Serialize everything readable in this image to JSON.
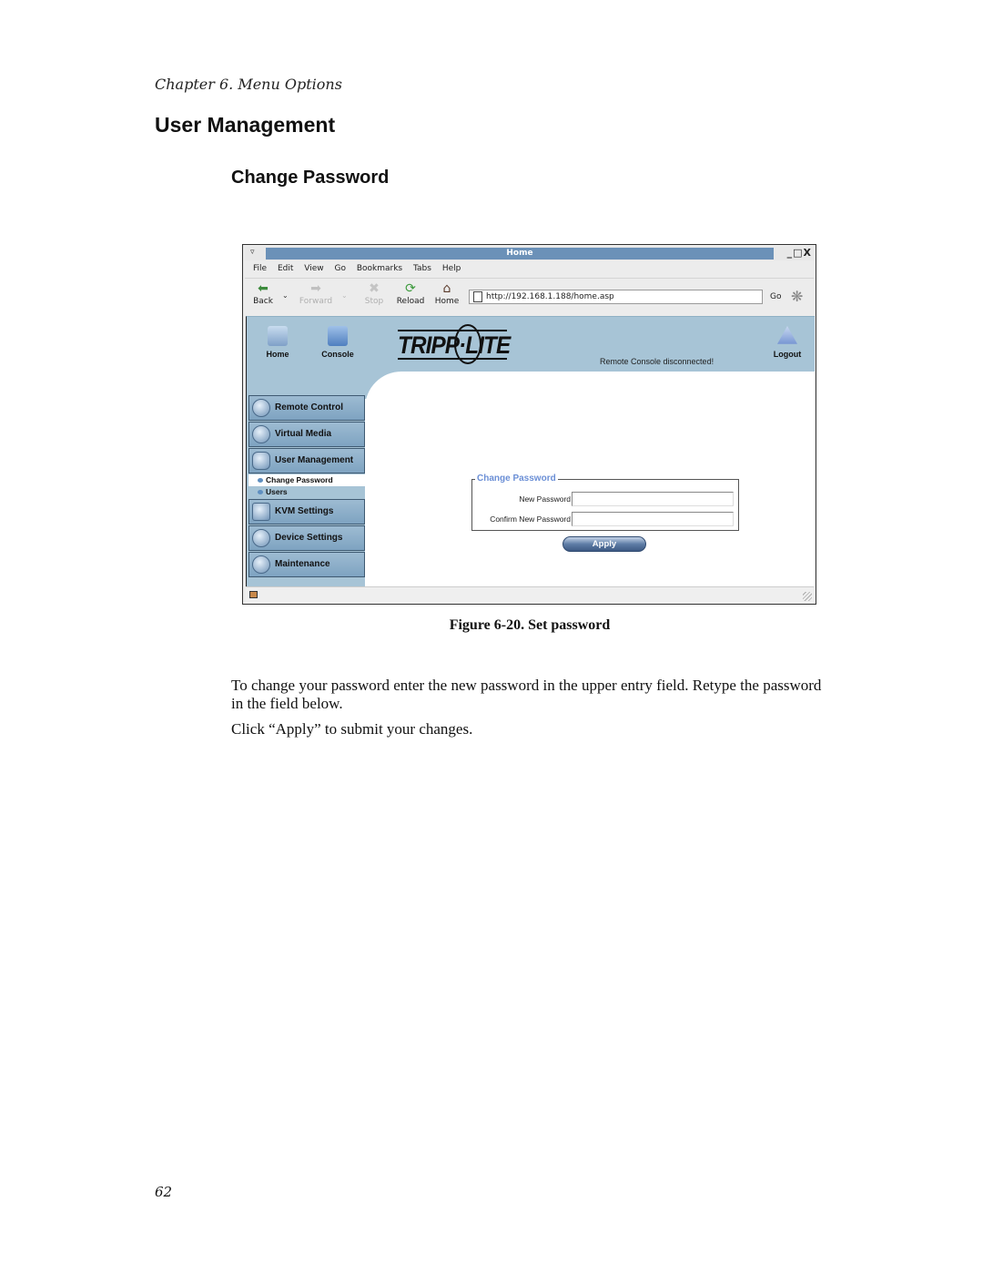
{
  "document": {
    "chapter_header": "Chapter 6. Menu Options",
    "section_title": "User Management",
    "subsection_title": "Change Password",
    "figure_caption": "Figure 6-20. Set password",
    "paragraphs": [
      "To change your password enter the new password in the upper entry field. Retype the password in the field below.",
      "Click “Apply” to submit your changes."
    ],
    "page_number": "62"
  },
  "window": {
    "title": "Home",
    "window_menu_icon": "window-menu-icon",
    "controls": "_□X"
  },
  "menubar": {
    "items": [
      "File",
      "Edit",
      "View",
      "Go",
      "Bookmarks",
      "Tabs",
      "Help"
    ]
  },
  "toolbar": {
    "back": "Back",
    "forward": "Forward",
    "stop": "Stop",
    "reload": "Reload",
    "home": "Home",
    "url": "http://192.168.1.188/home.asp",
    "go": "Go"
  },
  "app": {
    "header_nav": {
      "home": "Home",
      "console": "Console",
      "logout": "Logout"
    },
    "logo_text": "TRIPP·LITE",
    "status_text": "Remote Console disconnected!",
    "sidebar": {
      "items": [
        "Remote Control",
        "Virtual Media",
        "User Management"
      ],
      "subitems": [
        "Change Password",
        "Users"
      ],
      "items_after": [
        "KVM Settings",
        "Device Settings",
        "Maintenance"
      ]
    },
    "form": {
      "legend": "Change Password",
      "new_password_label": "New Password",
      "new_password_value": "",
      "confirm_password_label": "Confirm New Password",
      "confirm_password_value": "",
      "apply_label": "Apply"
    }
  },
  "colors": {
    "title_bar": "#6b91b8",
    "app_header": "#a7c4d6",
    "legend_text": "#6b8fd6"
  }
}
